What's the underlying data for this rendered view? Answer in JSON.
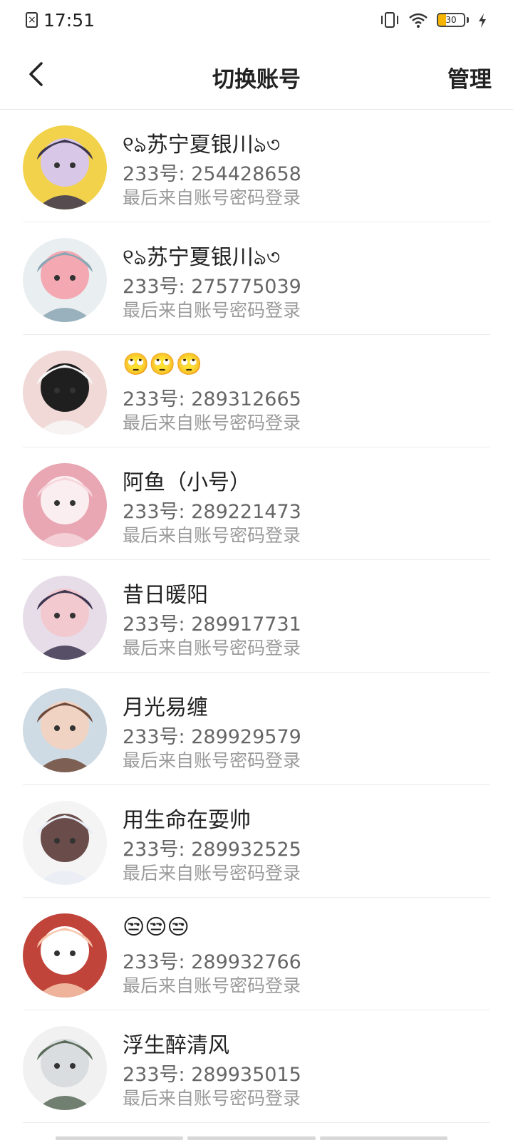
{
  "status": {
    "time": "17:51",
    "battery": "30",
    "battery_level": 0.3
  },
  "header": {
    "title": "切换账号",
    "manage": "管理"
  },
  "accounts": [
    {
      "nickname": "୧ঌ苏宁夏银川ঌ৩",
      "uid": "233号: 254428658",
      "hint": "最后来自账号密码登录",
      "colors": [
        "#3b3550",
        "#d8c7e6",
        "#f2d24a"
      ]
    },
    {
      "nickname": "୧ঌ苏宁夏银川ঌ৩",
      "uid": "233号: 275775039",
      "hint": "最后来自账号密码登录",
      "colors": [
        "#8aa6b3",
        "#f3a8b2",
        "#e9eef1"
      ]
    },
    {
      "nickname": "🙄🙄🙄",
      "uid": "233号: 289312665",
      "hint": "最后来自账号密码登录",
      "colors": [
        "#f7f7f7",
        "#1f1f1f",
        "#f0d9d6"
      ]
    },
    {
      "nickname": "阿鱼（小号）",
      "uid": "233号: 289221473",
      "hint": "最后来自账号密码登录",
      "colors": [
        "#f6d6dc",
        "#fbeef0",
        "#e8a7b2"
      ]
    },
    {
      "nickname": "昔日暖阳",
      "uid": "233号: 289917731",
      "hint": "最后来自账号密码登录",
      "colors": [
        "#3d3550",
        "#f2c9cf",
        "#e6dde8"
      ]
    },
    {
      "nickname": "月光易缠",
      "uid": "233号: 289929579",
      "hint": "最后来自账号密码登录",
      "colors": [
        "#6e4a3a",
        "#f0d3c2",
        "#cfdbe4"
      ]
    },
    {
      "nickname": "用生命在耍帅",
      "uid": "233号: 289932525",
      "hint": "最后来自账号密码登录",
      "colors": [
        "#e9edf5",
        "#6a4d4a",
        "#f4f4f4"
      ]
    },
    {
      "nickname": "😒😒😒",
      "uid": "233号: 289932766",
      "hint": "最后来自账号密码登录",
      "colors": [
        "#f7c6ad",
        "#ffffff",
        "#c0443a"
      ]
    },
    {
      "nickname": "浮生醉清风",
      "uid": "233号: 289935015",
      "hint": "最后来自账号密码登录",
      "colors": [
        "#5b6b5a",
        "#d9dde0",
        "#f1f1f1"
      ]
    }
  ]
}
